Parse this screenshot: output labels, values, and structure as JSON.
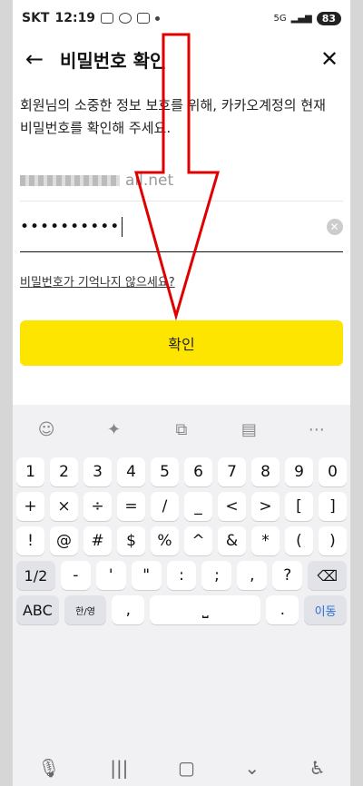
{
  "status": {
    "carrier": "SKT",
    "time": "12:19",
    "network": "5G",
    "battery": "83"
  },
  "appbar": {
    "back_icon": "arrow-left-icon",
    "title": "비밀번호 확인",
    "close_icon": "close-icon"
  },
  "description": {
    "line1": "회원님의 소중한 정보 보호를 위해, 카카오계정의 현재",
    "line2": "비밀번호를 확인해 주세요."
  },
  "email": {
    "visible_suffix": "ail.net"
  },
  "password": {
    "value": "••••••••••"
  },
  "forgot_link": "비밀번호가 기억나지 않으세요?",
  "confirm_button": "확인",
  "keyboard": {
    "row1": [
      "1",
      "2",
      "3",
      "4",
      "5",
      "6",
      "7",
      "8",
      "9",
      "0"
    ],
    "row2": [
      "+",
      "×",
      "÷",
      "=",
      "/",
      "_",
      "<",
      ">",
      "[",
      "]"
    ],
    "row3": [
      "!",
      "@",
      "#",
      "$",
      "%",
      "^",
      "&",
      "*",
      "(",
      ")"
    ],
    "row4_left": "1/2",
    "row4": [
      "-",
      "'",
      "\"",
      ":",
      ";",
      ",",
      "?"
    ],
    "row5_left": "ABC",
    "row5_lang": "한/영",
    "row5_comma": ",",
    "row5_period": ".",
    "enter": "이동"
  },
  "colors": {
    "accent": "#fee500",
    "annotation": "#e00000"
  }
}
